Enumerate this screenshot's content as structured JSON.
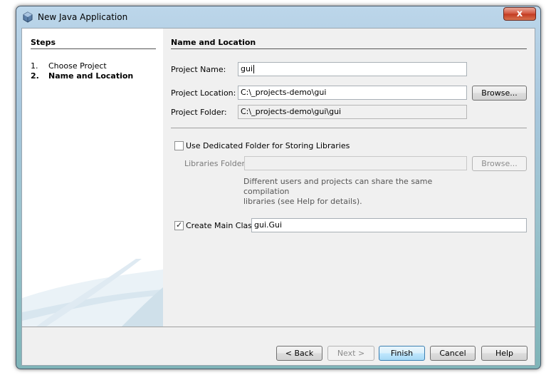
{
  "window": {
    "title": "New Java Application",
    "close_label": "x"
  },
  "steps": {
    "heading": "Steps",
    "items": [
      {
        "num": "1.",
        "label": "Choose Project"
      },
      {
        "num": "2.",
        "label": "Name and Location"
      }
    ]
  },
  "panel": {
    "heading": "Name and Location",
    "project_name_label": "Project Name:",
    "project_name_value": "gui",
    "project_location_label": "Project Location:",
    "project_location_value": "C:\\_projects-demo\\gui",
    "browse_label": "Browse...",
    "project_folder_label": "Project Folder:",
    "project_folder_value": "C:\\_projects-demo\\gui\\gui",
    "dedicated_folder_label": "Use Dedicated Folder for Storing Libraries",
    "dedicated_folder_checked": false,
    "libraries_folder_label": "Libraries Folder:",
    "libraries_folder_value": "",
    "libraries_browse_label": "Browse...",
    "libraries_help_line1": "Different users and projects can share the same compilation",
    "libraries_help_line2": "libraries (see Help for details).",
    "create_main_class_label": "Create Main Class",
    "create_main_class_checked": true,
    "main_class_value": "gui.Gui"
  },
  "footer": {
    "back_label": "< Back",
    "next_label": "Next >",
    "finish_label": "Finish",
    "cancel_label": "Cancel",
    "help_label": "Help"
  }
}
